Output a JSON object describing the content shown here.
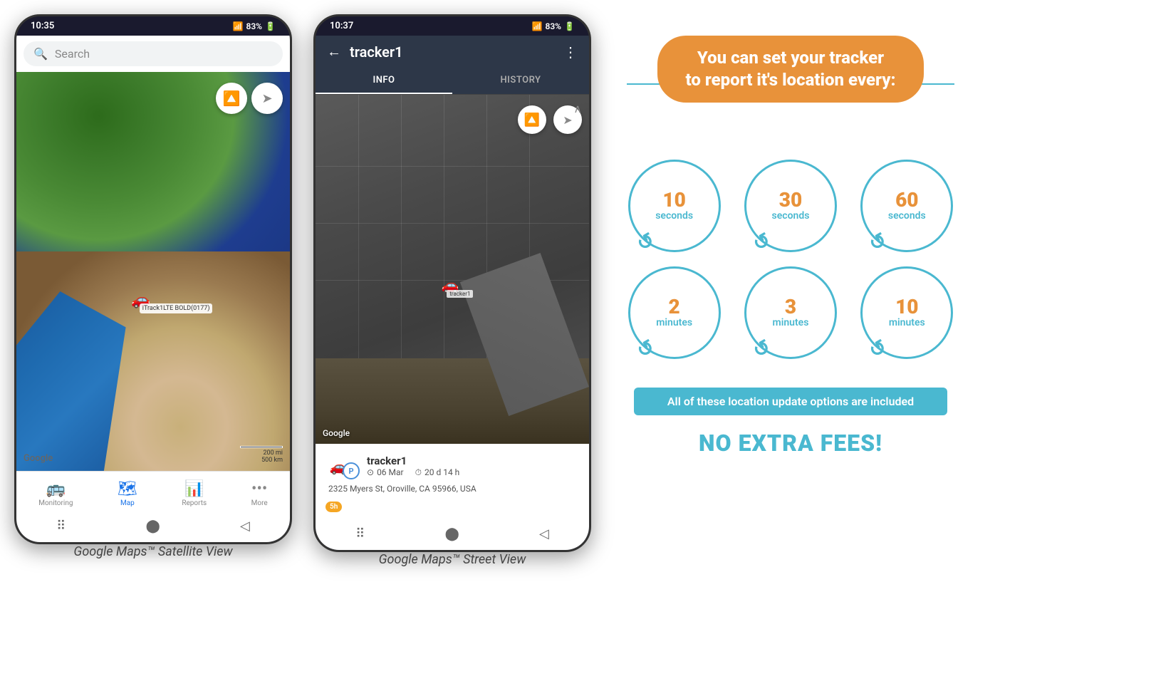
{
  "phone1": {
    "status_time": "10:35",
    "status_signal": "▲▲▲",
    "status_battery": "83%",
    "search_placeholder": "Search",
    "compass_icon": "🔴",
    "tracker_label": "iTrack1LTE BOLD(0177)",
    "google_logo": "Google",
    "scale_200mi": "200 mi",
    "scale_500km": "500 km",
    "nav_items": [
      {
        "label": "Monitoring",
        "icon": "🚌",
        "active": false
      },
      {
        "label": "Map",
        "icon": "🗺",
        "active": true
      },
      {
        "label": "Reports",
        "icon": "📊",
        "active": false
      },
      {
        "label": "More",
        "icon": "•••",
        "active": false
      }
    ],
    "caption": "Google Maps™ Satellite View"
  },
  "phone2": {
    "status_time": "10:37",
    "status_signal": "▲▲▲",
    "status_battery": "83%",
    "back_icon": "←",
    "tracker_title": "tracker1",
    "more_icon": "⋮",
    "tabs": [
      {
        "label": "INFO",
        "active": true
      },
      {
        "label": "HISTORY",
        "active": false
      }
    ],
    "google_logo": "Google",
    "tracker_name": "tracker1",
    "tracker_date": "06 Mar",
    "tracker_duration": "20 d 14 h",
    "tracker_address": "2325 Myers St, Oroville, CA 95966, USA",
    "tracker_badge": "5h",
    "caption": "Google Maps™ Street View"
  },
  "right_panel": {
    "headline_line1": "You can set your tracker",
    "headline_line2": "to report it's location every:",
    "intervals": [
      {
        "number": "10",
        "unit": "seconds"
      },
      {
        "number": "30",
        "unit": "seconds"
      },
      {
        "number": "60",
        "unit": "seconds"
      },
      {
        "number": "2",
        "unit": "minutes"
      },
      {
        "number": "3",
        "unit": "minutes"
      },
      {
        "number": "10",
        "unit": "minutes"
      }
    ],
    "no_fees_banner": "All of these location update options are included",
    "no_fees_text": "NO EXTRA FEES!"
  }
}
